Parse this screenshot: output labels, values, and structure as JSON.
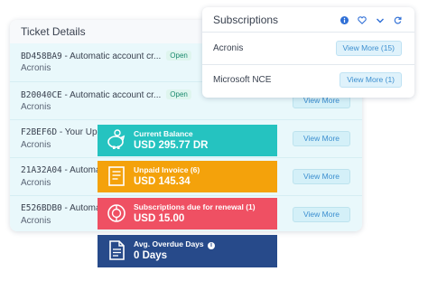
{
  "ticket_details": {
    "title": "Ticket Details",
    "rows": [
      {
        "code": "BD458BA9",
        "subject": " - Automatic account cr...",
        "customer": "Acronis",
        "status": "Open",
        "action": ""
      },
      {
        "code": "B20040CE",
        "subject": " - Automatic account cr...",
        "customer": "Acronis",
        "status": "Open",
        "action": "View More"
      },
      {
        "code": "F2BEF6D",
        "subject": " - Your Upgr",
        "customer": "Acronis",
        "status": "",
        "action": "View More"
      },
      {
        "code": "21A32A04",
        "subject": " - Automat",
        "customer": "Acronis",
        "status": "",
        "action": "View More"
      },
      {
        "code": "E526BDB0",
        "subject": " - Automat",
        "customer": "Acronis",
        "status": "",
        "action": "View More"
      }
    ]
  },
  "subscriptions": {
    "title": "Subscriptions",
    "icons": [
      "info-icon",
      "heart-icon",
      "chevron-down-icon",
      "refresh-icon"
    ],
    "rows": [
      {
        "name": "Acronis",
        "action": "View More (15)"
      },
      {
        "name": "Microsoft NCE",
        "action": "View More (1)"
      }
    ]
  },
  "kpis": [
    {
      "label": "Current Balance",
      "value": "USD 295.77 DR",
      "color": "#25c3c0",
      "icon": "piggy-bank-icon"
    },
    {
      "label": "Unpaid Invoice (6)",
      "value": "USD 145.34",
      "color": "#f4a20b",
      "icon": "invoice-icon"
    },
    {
      "label": "Subscriptions due for renewal (1)",
      "value": "USD 15.00",
      "color": "#ef5063",
      "icon": "renewal-icon"
    },
    {
      "label": "Avg. Overdue Days",
      "value": "0 Days",
      "color": "#274a8a",
      "icon": "document-icon",
      "info": "i"
    }
  ]
}
